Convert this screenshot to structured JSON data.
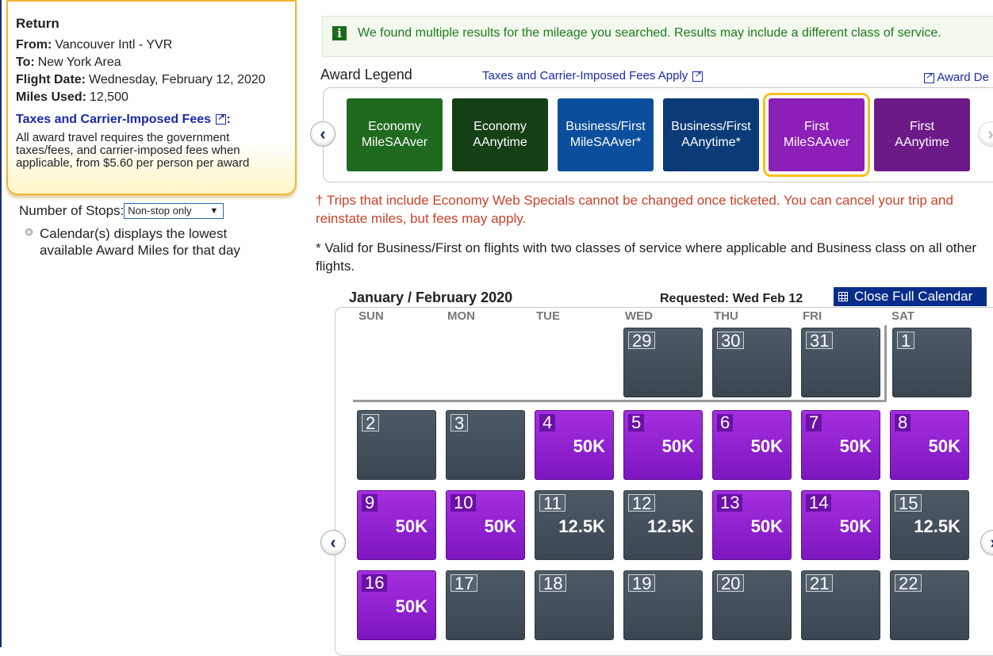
{
  "summary": {
    "title": "Return",
    "from_label": "From:",
    "from_value": "Vancouver Intl - YVR",
    "to_label": "To:",
    "to_value": "New York Area",
    "date_label": "Flight Date:",
    "date_value": "Wednesday, February 12, 2020",
    "miles_label": "Miles Used:",
    "miles_value": "12,500",
    "fees_link": "Taxes and Carrier-Imposed Fees",
    "fees_colon": ":",
    "fees_note": "All award travel requires the government taxes/fees, and carrier-imposed fees when applicable, from $5.60 per person per award"
  },
  "filters": {
    "stops_label": "Number of Stops:",
    "stops_value": "Non-stop only",
    "calendar_note": "Calendar(s) displays the lowest available Award Miles for that day"
  },
  "banner": {
    "icon": "info-icon",
    "text": "We found multiple results for the mileage you searched. Results may include a different class of service."
  },
  "legend": {
    "title": "Award Legend",
    "tax_link": "Taxes and Carrier-Imposed Fees Apply",
    "award_details": "Award De",
    "items": [
      {
        "line1": "Economy",
        "line2": "MileSAAver",
        "color": "#1f6a1f"
      },
      {
        "line1": "Economy",
        "line2": "AAnytime",
        "color": "#153f15"
      },
      {
        "line1": "Business/First",
        "line2": "MileSAAver*",
        "color": "#0b4f9c"
      },
      {
        "line1": "Business/First",
        "line2": "AAnytime*",
        "color": "#0a3a78"
      },
      {
        "line1": "First",
        "line2": "MileSAAver",
        "color": "#8b1fb8"
      },
      {
        "line1": "First",
        "line2": "AAnytime",
        "color": "#6c1a88"
      }
    ]
  },
  "notes": {
    "web_special": "† Trips that include Economy Web Specials cannot be changed once ticketed. You can cancel your trip and reinstate miles, but fees may apply.",
    "valid": "* Valid for Business/First on flights with two classes of service where applicable and Business class on all other flights."
  },
  "calendar": {
    "month": "January / February 2020",
    "requested": "Requested: Wed Feb 12",
    "close_button": "Close Full Calendar",
    "dow": [
      "SUN",
      "MON",
      "TUE",
      "WED",
      "THU",
      "FRI",
      "SAT"
    ],
    "weeks": [
      [
        null,
        null,
        null,
        {
          "day": "29",
          "val": "",
          "type": "grey"
        },
        {
          "day": "30",
          "val": "",
          "type": "grey"
        },
        {
          "day": "31",
          "val": "",
          "type": "grey"
        },
        {
          "day": "1",
          "val": "",
          "type": "grey"
        }
      ],
      [
        {
          "day": "2",
          "val": "",
          "type": "grey"
        },
        {
          "day": "3",
          "val": "",
          "type": "grey"
        },
        {
          "day": "4",
          "val": "50K",
          "type": "purple"
        },
        {
          "day": "5",
          "val": "50K",
          "type": "purple"
        },
        {
          "day": "6",
          "val": "50K",
          "type": "purple"
        },
        {
          "day": "7",
          "val": "50K",
          "type": "purple"
        },
        {
          "day": "8",
          "val": "50K",
          "type": "purple"
        }
      ],
      [
        {
          "day": "9",
          "val": "50K",
          "type": "purple"
        },
        {
          "day": "10",
          "val": "50K",
          "type": "purple"
        },
        {
          "day": "11",
          "val": "12.5K",
          "type": "grey"
        },
        {
          "day": "12",
          "val": "12.5K",
          "type": "grey"
        },
        {
          "day": "13",
          "val": "50K",
          "type": "purple"
        },
        {
          "day": "14",
          "val": "50K",
          "type": "purple"
        },
        {
          "day": "15",
          "val": "12.5K",
          "type": "grey"
        }
      ],
      [
        {
          "day": "16",
          "val": "50K",
          "type": "purple"
        },
        {
          "day": "17",
          "val": "",
          "type": "grey"
        },
        {
          "day": "18",
          "val": "",
          "type": "grey"
        },
        {
          "day": "19",
          "val": "",
          "type": "grey"
        },
        {
          "day": "20",
          "val": "",
          "type": "grey"
        },
        {
          "day": "21",
          "val": "",
          "type": "grey"
        },
        {
          "day": "22",
          "val": "",
          "type": "grey"
        }
      ]
    ]
  }
}
